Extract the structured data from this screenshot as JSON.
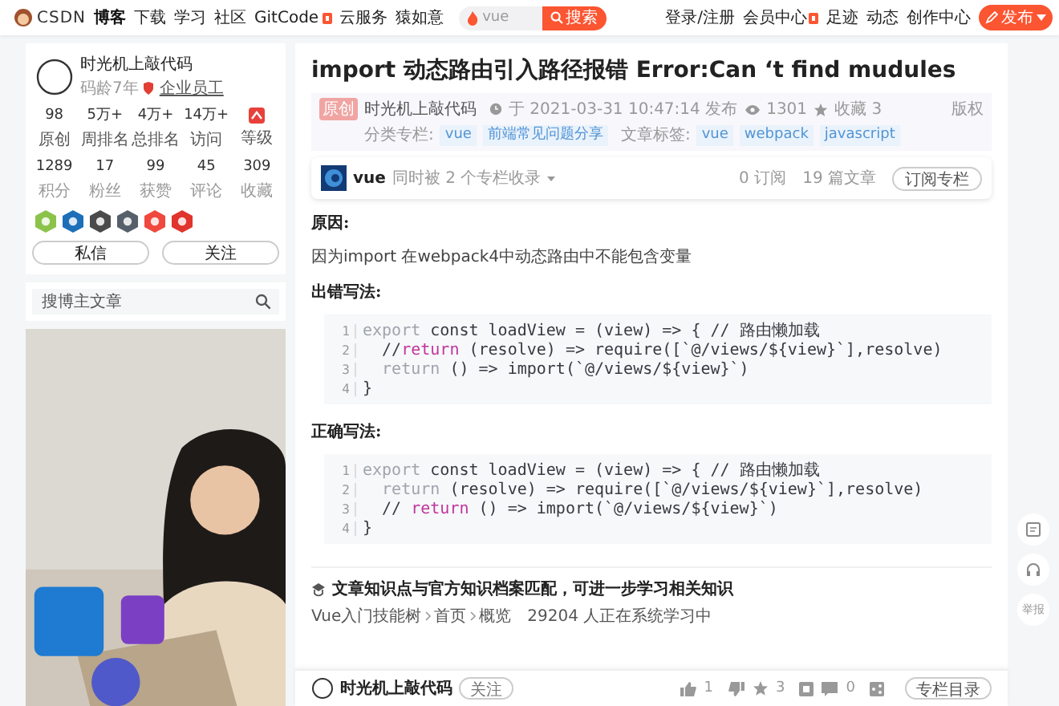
{
  "header": {
    "logo": "CSDN",
    "nav": [
      {
        "label": "博客",
        "selected": true,
        "badge": false
      },
      {
        "label": "下载",
        "selected": false,
        "badge": false
      },
      {
        "label": "学习",
        "selected": false,
        "badge": false
      },
      {
        "label": "社区",
        "selected": false,
        "badge": false
      },
      {
        "label": "GitCode",
        "selected": false,
        "badge": true
      },
      {
        "label": "云服务",
        "selected": false,
        "badge": false
      },
      {
        "label": "猿如意",
        "selected": false,
        "badge": false
      }
    ],
    "search": {
      "placeholder": "vue",
      "button": "搜索"
    },
    "links": [
      {
        "label": "登录/注册",
        "badge": false
      },
      {
        "label": "会员中心",
        "badge": true
      },
      {
        "label": "足迹",
        "badge": false
      },
      {
        "label": "动态",
        "badge": false
      },
      {
        "label": "创作中心",
        "badge": false
      }
    ],
    "publish": "发布"
  },
  "profile": {
    "name": "时光机上敲代码",
    "age": "码龄7年",
    "role": "企业员工",
    "stats": [
      {
        "value": "98",
        "label": "原创",
        "kind": "text"
      },
      {
        "value": "5万+",
        "label": "周排名",
        "kind": "text"
      },
      {
        "value": "4万+",
        "label": "总排名",
        "kind": "text"
      },
      {
        "value": "14万+",
        "label": "访问",
        "kind": "text"
      },
      {
        "label": "等级",
        "kind": "icon"
      }
    ],
    "stats2": [
      {
        "value": "1289",
        "label": "积分"
      },
      {
        "value": "17",
        "label": "粉丝"
      },
      {
        "value": "99",
        "label": "获赞"
      },
      {
        "value": "45",
        "label": "评论"
      },
      {
        "value": "309",
        "label": "收藏"
      }
    ],
    "buttons": [
      "私信",
      "关注"
    ]
  },
  "blog_search": {
    "placeholder": "搜博主文章"
  },
  "article": {
    "title": "import 动态路由引入路径报错 Error:Can ‘t find mudules",
    "tag": "原创",
    "author": "时光机上敲代码",
    "published": "于 2021-03-31 10:47:14 发布",
    "views": "1301",
    "favorites": "收藏 3",
    "copyright": "版权",
    "category_label": "分类专栏:",
    "categories": [
      "vue",
      "前端常见问题分享"
    ],
    "tags_label": "文章标签:",
    "tags": [
      "vue",
      "webpack",
      "javascript"
    ],
    "column": {
      "name": "vue",
      "note": "同时被 2 个专栏收录",
      "subscribers": "0 订阅",
      "articles": "19 篇文章",
      "button": "订阅专栏"
    },
    "body": [
      {
        "kind": "heading",
        "text": "原因:"
      },
      {
        "kind": "paragraph",
        "text": "因为import 在webpack4中动态路由中不能包含变量"
      },
      {
        "kind": "heading",
        "text": "出错写法:"
      },
      {
        "kind": "code",
        "lines": [
          {
            "number": "1",
            "segments": [
              {
                "text": "export",
                "kind": "keyword"
              },
              {
                "text": " const loadView = (view) => { // 路由懒加载",
                "kind": "plain"
              }
            ]
          },
          {
            "number": "2",
            "segments": [
              {
                "text": "  //",
                "kind": "plain"
              },
              {
                "text": "return",
                "kind": "highlight"
              },
              {
                "text": " (resolve) => require([`@/views/${view}`],resolve)",
                "kind": "plain"
              }
            ]
          },
          {
            "number": "3",
            "segments": [
              {
                "text": "  return",
                "kind": "keyword"
              },
              {
                "text": " () => import(`@/views/${view}`)",
                "kind": "plain"
              }
            ]
          },
          {
            "number": "4",
            "segments": [
              {
                "text": "}",
                "kind": "plain"
              }
            ]
          }
        ]
      },
      {
        "kind": "heading",
        "text": "正确写法:"
      },
      {
        "kind": "code",
        "lines": [
          {
            "number": "1",
            "segments": [
              {
                "text": "export",
                "kind": "keyword"
              },
              {
                "text": " const loadView = (view) => { // 路由懒加载",
                "kind": "plain"
              }
            ]
          },
          {
            "number": "2",
            "segments": [
              {
                "text": "  return",
                "kind": "keyword"
              },
              {
                "text": " (resolve) => require([`@/views/${view}`],resolve)",
                "kind": "plain"
              }
            ]
          },
          {
            "number": "3",
            "segments": [
              {
                "text": "  // ",
                "kind": "plain"
              },
              {
                "text": "return",
                "kind": "highlight"
              },
              {
                "text": " () => import(`@/views/${view}`)",
                "kind": "plain"
              }
            ]
          },
          {
            "number": "4",
            "segments": [
              {
                "text": "}",
                "kind": "plain"
              }
            ]
          }
        ]
      }
    ],
    "knowledge": {
      "title": "文章知识点与官方知识档案匹配，可进一步学习相关知识",
      "path": [
        "Vue入门技能树",
        "首页",
        "概览"
      ],
      "learners": "29204 人正在系统学习中"
    }
  },
  "toolbar": {
    "author": "时光机上敲代码",
    "follow": "关注",
    "likes": "1",
    "stars": "3",
    "comments": "0",
    "toc": "专栏目录"
  },
  "side_tools": {
    "report": "举报"
  }
}
